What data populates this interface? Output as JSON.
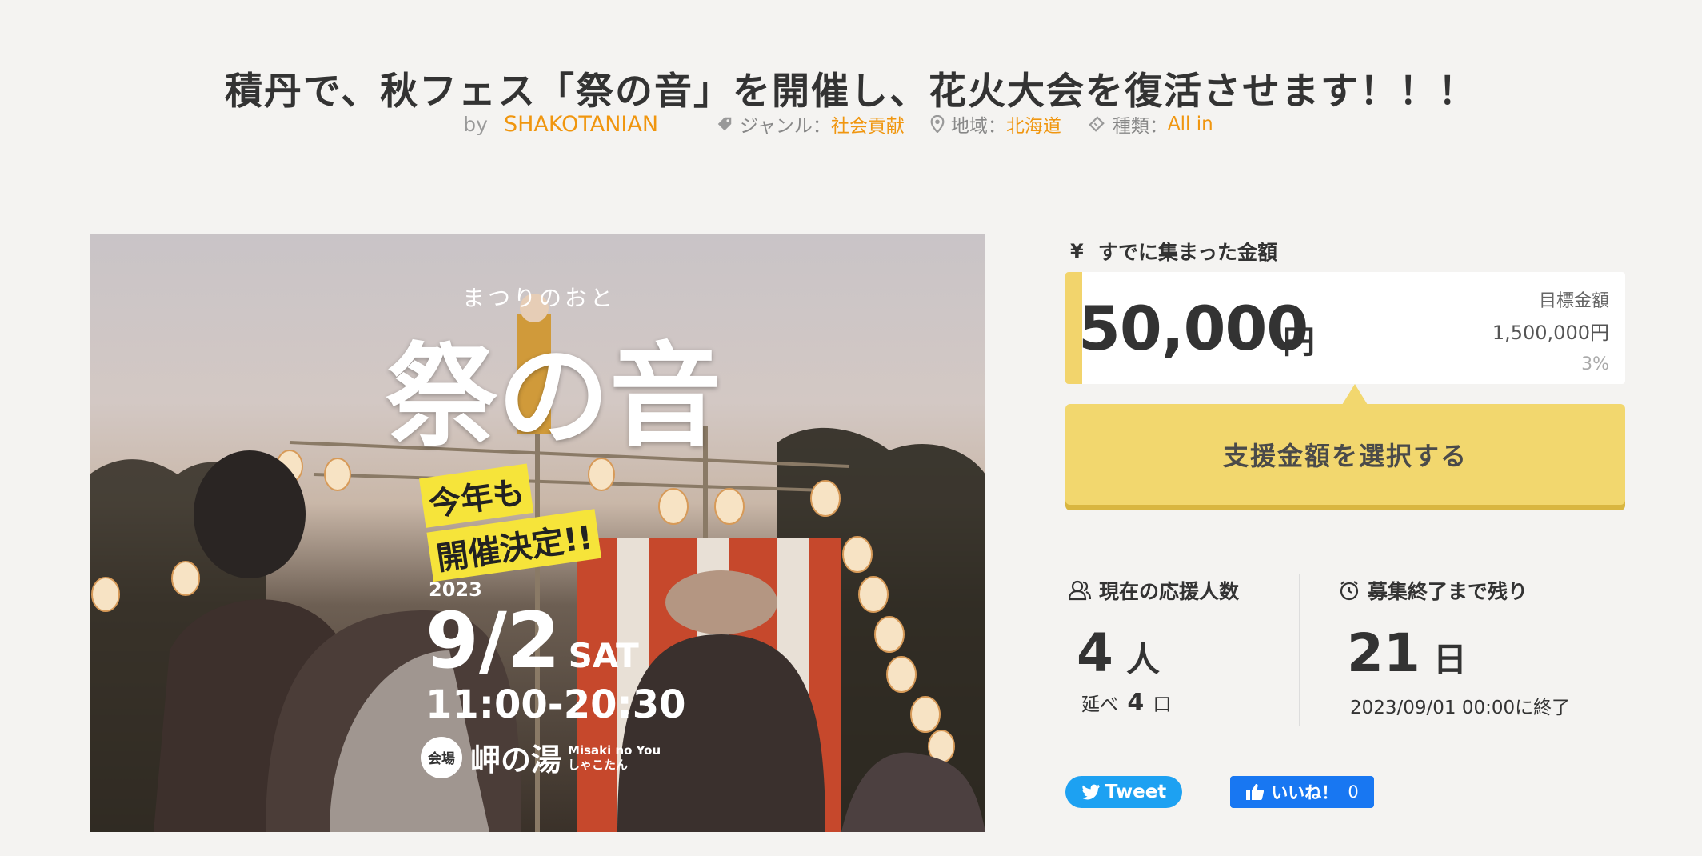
{
  "project": {
    "title": "積丹で、秋フェス「祭の音」を開催し、花火大会を復活させます！！！",
    "by_label": "by",
    "author": "SHAKOTANIAN",
    "genre_label": "ジャンル：",
    "genre": "社会貢献",
    "region_label": "地域：",
    "region": "北海道",
    "type_label": "種類：",
    "type": "All in"
  },
  "hero": {
    "kana": "まつりのおと",
    "title": "祭の音",
    "badge_line1": "今年も",
    "badge_line2": "開催決定!!",
    "year": "2023",
    "date": "9/2",
    "day": "SAT",
    "time": "11:00-20:30",
    "venue_tag": "会場",
    "venue": "岬の湯",
    "venue_en": "Misaki no You",
    "venue_kana": "しゃこたん"
  },
  "funding": {
    "raised_icon": "¥",
    "raised_label": "すでに集まった金額",
    "amount": "50,000",
    "unit": "円",
    "goal_label": "目標金額",
    "goal": "1,500,000円",
    "percent": "3%",
    "progress_fraction": 0.03,
    "support_button": "支援金額を選択する"
  },
  "stats": {
    "supporters_label": "現在の応援人数",
    "supporters": "4",
    "supporters_unit": "人",
    "total_prefix": "延べ",
    "total": "4",
    "total_unit": "口",
    "remaining_label": "募集終了まで残り",
    "remaining": "21",
    "remaining_unit": "日",
    "deadline": "2023/09/01 00:00に終了"
  },
  "social": {
    "tweet": "Tweet",
    "like": "いいね！",
    "like_count": "0"
  },
  "colors": {
    "accent_orange": "#f0960f",
    "button_yellow": "#f2d76e",
    "progress_yellow": "#f2d46c",
    "twitter": "#1da1f2",
    "facebook": "#1877f2"
  }
}
